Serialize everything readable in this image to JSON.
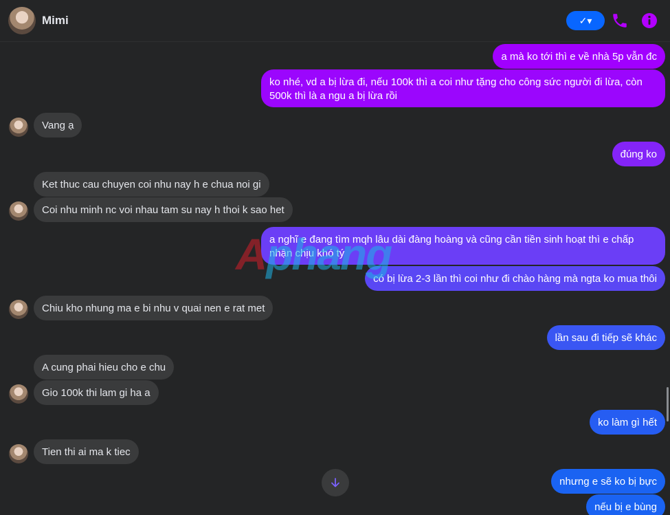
{
  "header": {
    "name": "Mimi",
    "status_glyph": "✓▾",
    "icons": [
      "avatar",
      "check-dropdown-icon",
      "phone-icon",
      "info-icon"
    ]
  },
  "colors": {
    "background": "#242526",
    "incoming_bubble": "#3a3b3c",
    "outgoing_purple": "#a100ff",
    "outgoing_violet": "#7e2cf7",
    "outgoing_blue": "#1a63f2",
    "accent_icon": "#b300ff"
  },
  "messages": [
    {
      "dir": "out",
      "text": "a mà ko tới thì e về nhà 5p vẫn đc"
    },
    {
      "dir": "out",
      "text": "ko nhé, vd a bị lừa đi, nếu 100k thì a coi như tặng cho công sức người đi lừa, còn 500k thì là a ngu a bị lừa rồi"
    },
    {
      "dir": "in",
      "text": "Vang ạ"
    },
    {
      "dir": "out",
      "text": "đúng ko"
    },
    {
      "dir": "in",
      "text": "Ket thuc cau chuyen coi nhu nay h e chua noi gi"
    },
    {
      "dir": "in",
      "text": "Coi nhu minh nc voi nhau tam su nay h thoi k sao het"
    },
    {
      "dir": "out",
      "text": "a nghĩ e đang tìm mqh lâu dài đàng hoàng và cũng cần tiền sinh hoạt thì e chấp nhận chịu khó tý"
    },
    {
      "dir": "out",
      "text": "có bị lừa 2-3 lần thì coi như đi chào hàng mà ngta ko mua thôi"
    },
    {
      "dir": "in",
      "text": "Chiu kho nhung ma e bi nhu v quai nen e rat met"
    },
    {
      "dir": "out",
      "text": "lần sau đi tiếp sẽ khác"
    },
    {
      "dir": "in",
      "text": "A cung phai hieu cho e chu"
    },
    {
      "dir": "in",
      "text": "Gio 100k thi lam gi ha a"
    },
    {
      "dir": "out",
      "text": "ko làm gì hết"
    },
    {
      "dir": "in",
      "text": "Tien thi ai ma k tiec"
    },
    {
      "dir": "out",
      "text": "nhưng e sẽ ko bị bực"
    },
    {
      "dir": "out",
      "text": "nếu bị e bùng"
    }
  ],
  "watermark": {
    "first": "A",
    "rest": "phang"
  }
}
